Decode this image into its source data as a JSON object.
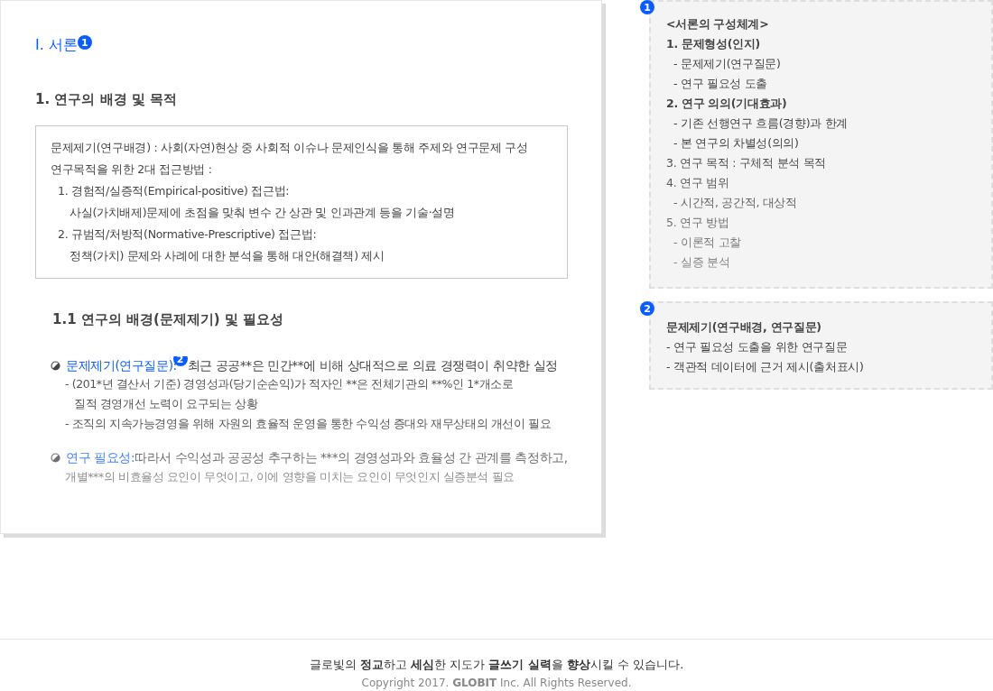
{
  "document": {
    "title": "Ⅰ. 서론",
    "title_badge": "1",
    "section": "1. 연구의 배경 및 목적",
    "summary_box": [
      {
        "kind": "line",
        "text": "문제제기(연구배경) : 사회(자연)현상 중 사회적 이슈나 문제인식을 통해 주제와 연구문제 구성"
      },
      {
        "kind": "line",
        "text": "연구목적을 위한 2대 접근방법 :"
      },
      {
        "kind": "numbered",
        "text": "1. 경험적/실증적(Empirical-positive) 접근법:"
      },
      {
        "kind": "detail",
        "text": "사실(가치배제)문제에 초점을 맞춰 변수 간 상관 및 인과관계 등을 기술·설명"
      },
      {
        "kind": "numbered",
        "text": "2. 규범적/처방적(Normative-Prescriptive) 접근법:"
      },
      {
        "kind": "detail",
        "text": "정책(가치) 문제와 사례에 대한 분석을 통해 대안(해결책) 제시"
      }
    ],
    "subsection": "1.1 연구의 배경(문제제기) 및 필요성",
    "points": [
      {
        "lead": "문제제기(연구질문):",
        "badge": "2",
        "text": " 최근 공공**은 민간**에 비해 상대적으로 의료 경쟁력이 취약한 실정",
        "details": [
          "- (201*년 결산서 기준) 경영성과(당기순손익)가 적자인 **은 전체기관의 **%인 1*개소로",
          "질적 경영개선 노력이 요구되는 상황",
          "- 조직의 지속가능경영을 위해 자원의 효율적 운영을 통한 수익성 증대와 재무상태의 개선이 필요"
        ]
      },
      {
        "lead": "연구 필요성:",
        "text": " 따라서 수익성과 공공성 추구하는 ***의 경영성과와 효율성 간 관계를 측정하고,",
        "details": [
          "개별***의 비효율성 요인이 무엇이고, 이에 영향을 미치는 요인이 무엇인지 실증분석 필요"
        ]
      }
    ]
  },
  "notes": [
    {
      "badge": "1",
      "lines": [
        {
          "kind": "heading",
          "text": "<서론의 구성체계>"
        },
        {
          "kind": "heading",
          "text": "1. 문제형성(인지)"
        },
        {
          "kind": "item",
          "text": "- 문제제기(연구질문)"
        },
        {
          "kind": "item",
          "text": "- 연구 필요성 도출"
        },
        {
          "kind": "heading",
          "text": "2. 연구 의의(기대효과)"
        },
        {
          "kind": "item",
          "text": "- 기존 선행연구 흐름(경향)과 한계"
        },
        {
          "kind": "item",
          "text": "- 본 연구의 차별성(의의)"
        },
        {
          "kind": "line",
          "text": "3. 연구 목적 : 구체적 분석 목적"
        },
        {
          "kind": "line",
          "text": "4. 연구 범위"
        },
        {
          "kind": "item",
          "text": "- 시간적, 공간적, 대상적"
        },
        {
          "kind": "line",
          "text": "5. 연구 방법"
        },
        {
          "kind": "item",
          "text": "- 이론적 고찰"
        },
        {
          "kind": "item",
          "text": "- 실증 분석"
        }
      ],
      "faded": true
    },
    {
      "badge": "2",
      "lines": [
        {
          "kind": "heading",
          "text": "문제제기(연구배경, 연구질문)"
        },
        {
          "kind": "line",
          "text": "- 연구 필요성 도출을 위한 연구질문"
        },
        {
          "kind": "line",
          "text": "- 객관적 데이터에 근거 제시(출처표시)"
        }
      ],
      "faded": false
    }
  ],
  "footer": {
    "tagline": "글로빛의 **정교**하고 **세심**한 지도가 **글쓰기 실력**을 **향상**시킬 수 있습니다.",
    "copyright": "Copyright 2017. **GLOBIT** Inc. All Rights Reserved."
  }
}
